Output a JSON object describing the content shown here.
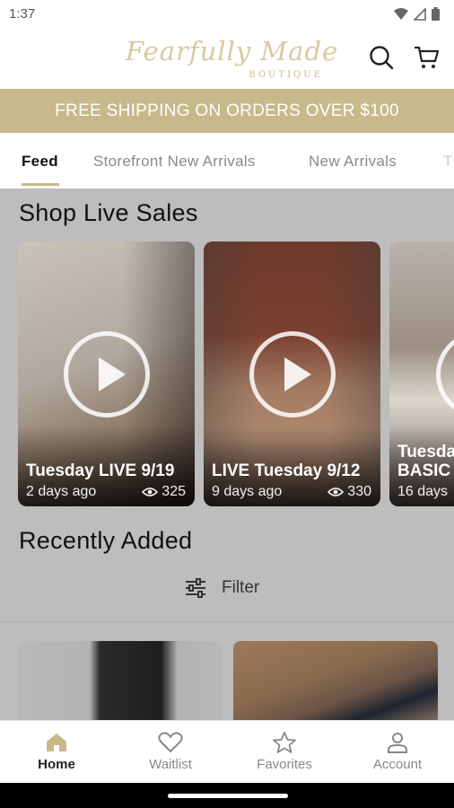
{
  "status_bar": {
    "time": "1:37",
    "icons": [
      "wifi-icon",
      "signal-icon",
      "battery-icon"
    ]
  },
  "header": {
    "logo_script": "Fearfully Made",
    "logo_sub": "BOUTIQUE",
    "search_icon": "search-icon",
    "cart_icon": "cart-icon"
  },
  "promo_banner": {
    "text": "FREE SHIPPING ON ORDERS OVER $100",
    "color": "#c8b98a"
  },
  "tabs": [
    {
      "label": "Feed",
      "active": true
    },
    {
      "label": "Storefront New Arrivals",
      "active": false
    },
    {
      "label": "New Arrivals",
      "active": false
    },
    {
      "label": "T",
      "active": false
    }
  ],
  "live_sales": {
    "title": "Shop Live Sales",
    "cards": [
      {
        "title": "Tuesday LIVE 9/19",
        "ago": "2 days ago",
        "views": "325"
      },
      {
        "title": "LIVE Tuesday 9/12",
        "ago": "9 days ago",
        "views": "330"
      },
      {
        "title": "Tuesda",
        "title2": "BASIC",
        "ago": "16 days"
      }
    ]
  },
  "recently_added": {
    "title": "Recently Added",
    "filter_label": "Filter"
  },
  "bottom_nav": [
    {
      "label": "Home",
      "icon": "home-icon",
      "active": true
    },
    {
      "label": "Waitlist",
      "icon": "heart-icon",
      "active": false
    },
    {
      "label": "Favorites",
      "icon": "star-icon",
      "active": false
    },
    {
      "label": "Account",
      "icon": "account-icon",
      "active": false
    }
  ],
  "colors": {
    "accent": "#c8b98a",
    "overlay": "#bdbdbd"
  }
}
